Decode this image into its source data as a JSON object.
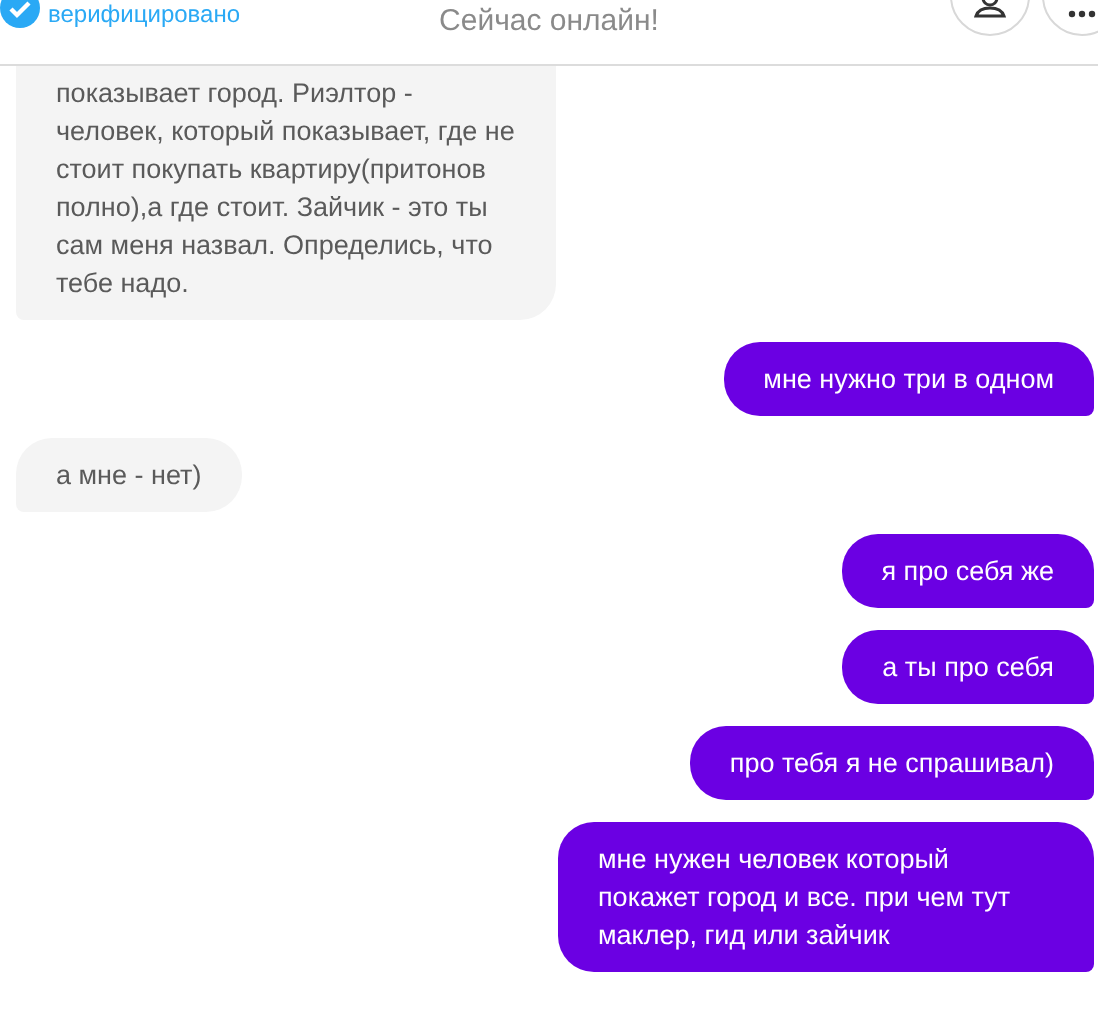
{
  "header": {
    "verified_label": "верифицировано",
    "status": "Сейчас онлайн!"
  },
  "messages": [
    {
      "kind": "received",
      "text": "показывает город. Риэлтор - человек, который показывает, где не стоит покупать квартиру(притонов полно),а где стоит. Зайчик - это ты сам меня назвал. Определись, что тебе надо."
    },
    {
      "kind": "sent",
      "text": "мне нужно три в одном"
    },
    {
      "kind": "received",
      "text": "а мне - нет)"
    },
    {
      "kind": "sent",
      "text": "я про себя же"
    },
    {
      "kind": "sent",
      "text": "а ты про себя"
    },
    {
      "kind": "sent",
      "text": "про тебя я не спрашивал)"
    },
    {
      "kind": "sent",
      "text": "мне нужен человек который покажет город и все. при чем тут маклер, гид или зайчик"
    }
  ]
}
